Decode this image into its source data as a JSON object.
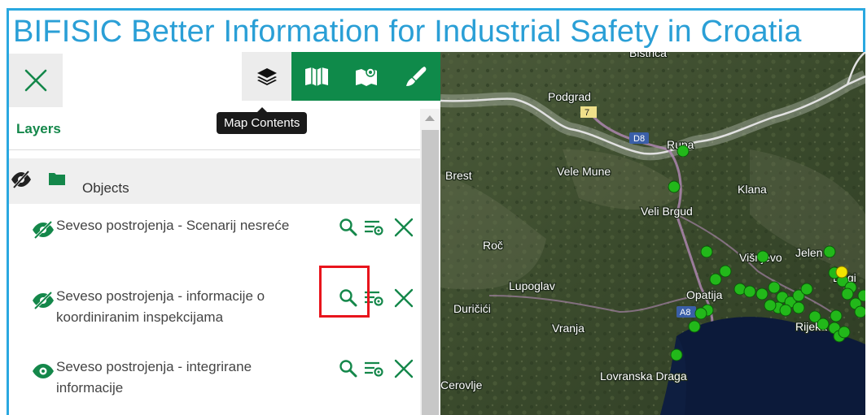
{
  "app": {
    "title": "BIFISIC Better Information for Industrial Safety in Croatia"
  },
  "toolbar": {
    "tools": [
      {
        "icon": "layers-icon",
        "active": true
      },
      {
        "icon": "map-book-icon",
        "active": false
      },
      {
        "icon": "map-legend-icon",
        "active": false
      },
      {
        "icon": "draw-pen-icon",
        "active": false
      }
    ],
    "tooltip": "Map Contents"
  },
  "layers_panel": {
    "heading": "Layers",
    "group": {
      "label": "Objects",
      "visibility_icon": "eye-off-icon",
      "folder_icon": "folder-icon"
    },
    "items": [
      {
        "name": "Seveso postrojenja - Scenarij nesreće",
        "visibility_icon": "eye-off-icon"
      },
      {
        "name": "Seveso postrojenja - informacije o koordiniranim inspekcijama",
        "visibility_icon": "eye-off-icon"
      },
      {
        "name": "Seveso postrojenja - integrirane informacije",
        "visibility_icon": "eye-icon"
      }
    ]
  },
  "map": {
    "labels": [
      "Bistrica",
      "Podgrad",
      "7",
      "D8",
      "Rupa",
      "Brest",
      "Vele Mune",
      "Klana",
      "Veli Brgud",
      "Roč",
      "Višnjevo",
      "Jelen",
      "Lupoglav",
      "Opatija",
      "Dugi",
      "A8",
      "Duričići",
      "Vranja",
      "Rijeka",
      "Lovranska Draga",
      "Cerovlje"
    ],
    "colors": {
      "marker": "#22b81a",
      "marker_highlight": "#f2e400",
      "border": "#d8d8d8",
      "sea": "#0c1a3a"
    }
  },
  "colors": {
    "accent": "#0f8a4a",
    "title": "#2a9fd6",
    "highlight_box": "#e8141c"
  }
}
